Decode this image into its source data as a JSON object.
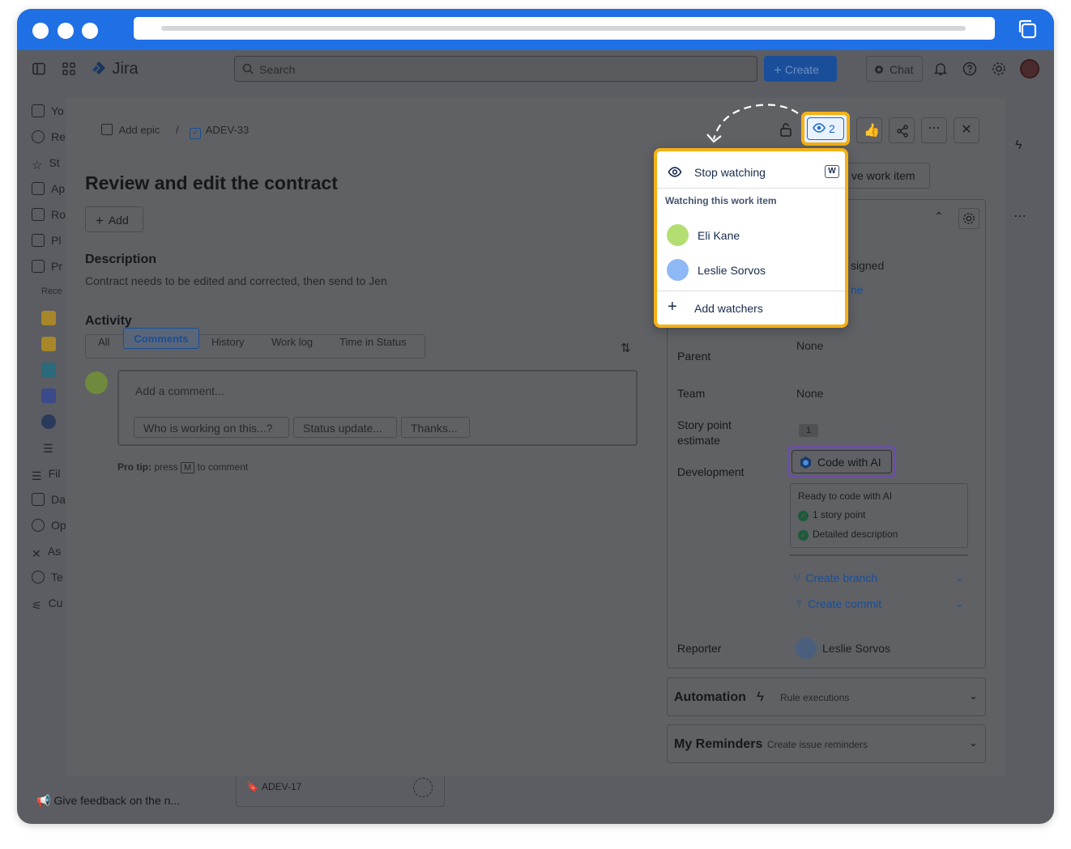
{
  "browser": {
    "icon": "copy-icon"
  },
  "appbar": {
    "logo": "Jira",
    "search_placeholder": "Search",
    "create_label": "Create",
    "chat_label": "Chat"
  },
  "sidebar": {
    "items": [
      "Yo",
      "Re",
      "St",
      "Ap",
      "Ro",
      "Pl",
      "Pr",
      "Rece",
      "Fil",
      "Da",
      "Op",
      "As",
      "Te",
      "Cu"
    ],
    "feedback": "Give feedback on the n..."
  },
  "background_card": {
    "key": "ADEV-17"
  },
  "issue": {
    "breadcrumb_epic": "Add epic",
    "breadcrumb_sep": "/",
    "breadcrumb_key": "ADEV-33",
    "title": "Review and edit the contract",
    "add_label": "Add",
    "description_heading": "Description",
    "description_text": "Contract needs to be edited and corrected, then send to Jen",
    "activity_heading": "Activity",
    "tabs": [
      "All",
      "Comments",
      "History",
      "Work log",
      "Time in Status"
    ],
    "comment_placeholder": "Add a comment...",
    "quick_replies": [
      "Who is working on this...?",
      "Status update...",
      "Thanks..."
    ],
    "protip_bold": "Pro tip:",
    "protip_press": "press",
    "protip_key": "M",
    "protip_rest": "to comment"
  },
  "header_actions": {
    "watch_count": "2"
  },
  "watch_popup": {
    "stop_watching": "Stop watching",
    "shortcut": "W",
    "section_title": "Watching this work item",
    "watchers": [
      {
        "name": "Eli Kane",
        "color": "#b3df72"
      },
      {
        "name": "Leslie Sorvos",
        "color": "#8fb8f6"
      }
    ],
    "add_watchers": "Add watchers"
  },
  "details": {
    "move_work_item_partial": "ve work item",
    "assignee_partial": "signed",
    "assign_link_partial": "ne",
    "parent_label": "Parent",
    "parent_value": "None",
    "team_label": "Team",
    "team_value": "None",
    "story_label_1": "Story point",
    "story_label_2": "estimate",
    "story_value": "1",
    "development_label": "Development",
    "code_ai_label": "Code with AI",
    "ready_title": "Ready to code with AI",
    "ready_items": [
      "1 story point",
      "Detailed description"
    ],
    "create_branch": "Create branch",
    "create_commit": "Create commit",
    "reporter_label": "Reporter",
    "reporter_value": "Leslie Sorvos",
    "automation_title": "Automation",
    "automation_sub": "Rule executions",
    "reminders_title": "My Reminders",
    "reminders_sub": "Create issue reminders"
  },
  "colors": {
    "brand_blue": "#1f6fe5",
    "highlight": "#f5b114",
    "ai_highlight": "#6a4fa3",
    "green_check": "#1f845a"
  }
}
